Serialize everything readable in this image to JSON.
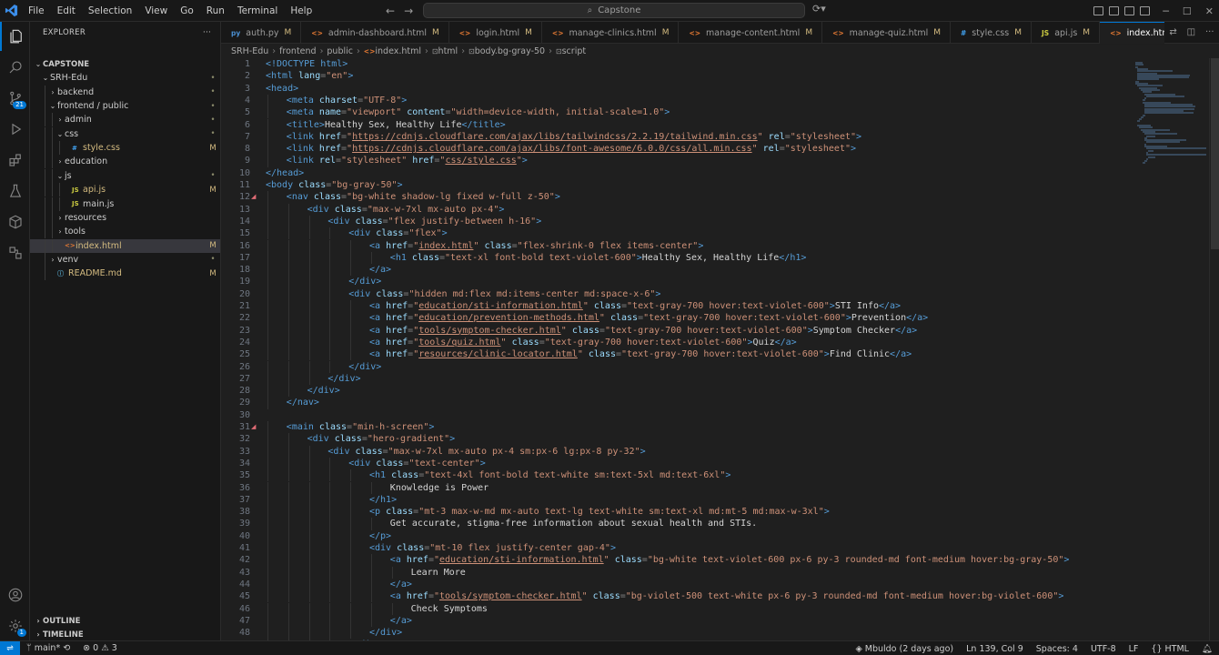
{
  "titlebar": {
    "logo": "VS",
    "menus": [
      "File",
      "Edit",
      "Selection",
      "View",
      "Go",
      "Run",
      "Terminal",
      "Help"
    ],
    "search_text": "Capstone"
  },
  "activity": {
    "scm_badge": "21",
    "accounts_badge": "1"
  },
  "explorer": {
    "title": "EXPLORER",
    "more": "···",
    "tree": [
      {
        "label": "CAPSTONE",
        "depth": 0,
        "chev": "v",
        "icon": "",
        "status": "",
        "bold": true
      },
      {
        "label": "SRH-Edu",
        "depth": 1,
        "chev": "v",
        "icon": "",
        "status": "•"
      },
      {
        "label": "backend",
        "depth": 2,
        "chev": ">",
        "icon": "",
        "status": "•"
      },
      {
        "label": "frontend / public",
        "depth": 2,
        "chev": "v",
        "icon": "",
        "status": "•"
      },
      {
        "label": "admin",
        "depth": 3,
        "chev": ">",
        "icon": "",
        "status": "•"
      },
      {
        "label": "css",
        "depth": 3,
        "chev": "v",
        "icon": "",
        "status": "•"
      },
      {
        "label": "style.css",
        "depth": 4,
        "chev": "",
        "icon": "css",
        "status": "M"
      },
      {
        "label": "education",
        "depth": 3,
        "chev": ">",
        "icon": "",
        "status": ""
      },
      {
        "label": "js",
        "depth": 3,
        "chev": "v",
        "icon": "",
        "status": "•"
      },
      {
        "label": "api.js",
        "depth": 4,
        "chev": "",
        "icon": "js",
        "status": "M"
      },
      {
        "label": "main.js",
        "depth": 4,
        "chev": "",
        "icon": "js",
        "status": ""
      },
      {
        "label": "resources",
        "depth": 3,
        "chev": ">",
        "icon": "",
        "status": ""
      },
      {
        "label": "tools",
        "depth": 3,
        "chev": ">",
        "icon": "",
        "status": ""
      },
      {
        "label": "index.html",
        "depth": 3,
        "chev": "",
        "icon": "html",
        "status": "M",
        "selected": true
      },
      {
        "label": "venv",
        "depth": 2,
        "chev": ">",
        "icon": "",
        "status": "•"
      },
      {
        "label": "README.md",
        "depth": 2,
        "chev": "",
        "icon": "md",
        "status": "M"
      }
    ],
    "outline": "OUTLINE",
    "timeline": "TIMELINE"
  },
  "tabs": [
    {
      "icon": "py",
      "label": "auth.py",
      "mod": "M"
    },
    {
      "icon": "<>",
      "label": "admin-dashboard.html",
      "mod": "M"
    },
    {
      "icon": "<>",
      "label": "login.html",
      "mod": "M"
    },
    {
      "icon": "<>",
      "label": "manage-clinics.html",
      "mod": "M"
    },
    {
      "icon": "<>",
      "label": "manage-content.html",
      "mod": "M"
    },
    {
      "icon": "<>",
      "label": "manage-quiz.html",
      "mod": "M"
    },
    {
      "icon": "#",
      "label": "style.css",
      "mod": "M"
    },
    {
      "icon": "JS",
      "label": "api.js",
      "mod": "M"
    },
    {
      "icon": "<>",
      "label": "index.html",
      "mod": "M",
      "active": true
    }
  ],
  "breadcrumbs": [
    "SRH-Edu",
    "frontend",
    "public",
    "index.html",
    "html",
    "body.bg-gray-50",
    "script"
  ],
  "code": [
    [
      0,
      [
        [
          "t",
          "<!DOCTYPE html>"
        ]
      ]
    ],
    [
      0,
      [
        [
          "t",
          "<html"
        ],
        [
          "a",
          " lang"
        ],
        [
          "p",
          "="
        ],
        [
          "s",
          "\"en\""
        ],
        [
          "t",
          ">"
        ]
      ]
    ],
    [
      0,
      [
        [
          "t",
          "<head>"
        ]
      ]
    ],
    [
      1,
      [
        [
          "t",
          "<meta"
        ],
        [
          "a",
          " charset"
        ],
        [
          "p",
          "="
        ],
        [
          "s",
          "\"UTF-8\""
        ],
        [
          "t",
          ">"
        ]
      ]
    ],
    [
      1,
      [
        [
          "t",
          "<meta"
        ],
        [
          "a",
          " name"
        ],
        [
          "p",
          "="
        ],
        [
          "s",
          "\"viewport\""
        ],
        [
          "a",
          " content"
        ],
        [
          "p",
          "="
        ],
        [
          "s",
          "\"width=device-width, initial-scale=1.0\""
        ],
        [
          "t",
          ">"
        ]
      ]
    ],
    [
      1,
      [
        [
          "t",
          "<title>"
        ],
        [
          "tx",
          "Healthy Sex, Healthy Life"
        ],
        [
          "t",
          "</title>"
        ]
      ]
    ],
    [
      1,
      [
        [
          "t",
          "<link"
        ],
        [
          "a",
          " href"
        ],
        [
          "p",
          "="
        ],
        [
          "s",
          "\""
        ],
        [
          "u",
          "https://cdnjs.cloudflare.com/ajax/libs/tailwindcss/2.2.19/tailwind.min.css"
        ],
        [
          "s",
          "\""
        ],
        [
          "a",
          " rel"
        ],
        [
          "p",
          "="
        ],
        [
          "s",
          "\"stylesheet\""
        ],
        [
          "t",
          ">"
        ]
      ]
    ],
    [
      1,
      [
        [
          "t",
          "<link"
        ],
        [
          "a",
          " href"
        ],
        [
          "p",
          "="
        ],
        [
          "s",
          "\""
        ],
        [
          "u",
          "https://cdnjs.cloudflare.com/ajax/libs/font-awesome/6.0.0/css/all.min.css"
        ],
        [
          "s",
          "\""
        ],
        [
          "a",
          " rel"
        ],
        [
          "p",
          "="
        ],
        [
          "s",
          "\"stylesheet\""
        ],
        [
          "t",
          ">"
        ]
      ]
    ],
    [
      1,
      [
        [
          "t",
          "<link"
        ],
        [
          "a",
          " rel"
        ],
        [
          "p",
          "="
        ],
        [
          "s",
          "\"stylesheet\""
        ],
        [
          "a",
          " href"
        ],
        [
          "p",
          "="
        ],
        [
          "s",
          "\""
        ],
        [
          "u",
          "css/style.css"
        ],
        [
          "s",
          "\""
        ],
        [
          "t",
          ">"
        ]
      ]
    ],
    [
      0,
      [
        [
          "t",
          "</head>"
        ]
      ]
    ],
    [
      0,
      [
        [
          "t",
          "<body"
        ],
        [
          "a",
          " class"
        ],
        [
          "p",
          "="
        ],
        [
          "s",
          "\"bg-gray-50\""
        ],
        [
          "t",
          ">"
        ]
      ]
    ],
    [
      1,
      [
        [
          "t",
          "<nav"
        ],
        [
          "a",
          " class"
        ],
        [
          "p",
          "="
        ],
        [
          "s",
          "\"bg-white shadow-lg fixed w-full z-50\""
        ],
        [
          "t",
          ">"
        ]
      ]
    ],
    [
      2,
      [
        [
          "t",
          "<div"
        ],
        [
          "a",
          " class"
        ],
        [
          "p",
          "="
        ],
        [
          "s",
          "\"max-w-7xl mx-auto px-4\""
        ],
        [
          "t",
          ">"
        ]
      ]
    ],
    [
      3,
      [
        [
          "t",
          "<div"
        ],
        [
          "a",
          " class"
        ],
        [
          "p",
          "="
        ],
        [
          "s",
          "\"flex justify-between h-16\""
        ],
        [
          "t",
          ">"
        ]
      ]
    ],
    [
      4,
      [
        [
          "t",
          "<div"
        ],
        [
          "a",
          " class"
        ],
        [
          "p",
          "="
        ],
        [
          "s",
          "\"flex\""
        ],
        [
          "t",
          ">"
        ]
      ]
    ],
    [
      5,
      [
        [
          "t",
          "<a"
        ],
        [
          "a",
          " href"
        ],
        [
          "p",
          "="
        ],
        [
          "s",
          "\""
        ],
        [
          "u",
          "index.html"
        ],
        [
          "s",
          "\""
        ],
        [
          "a",
          " class"
        ],
        [
          "p",
          "="
        ],
        [
          "s",
          "\"flex-shrink-0 flex items-center\""
        ],
        [
          "t",
          ">"
        ]
      ]
    ],
    [
      6,
      [
        [
          "t",
          "<h1"
        ],
        [
          "a",
          " class"
        ],
        [
          "p",
          "="
        ],
        [
          "s",
          "\"text-xl font-bold text-violet-600\""
        ],
        [
          "t",
          ">"
        ],
        [
          "tx",
          "Healthy Sex, Healthy Life"
        ],
        [
          "t",
          "</h1>"
        ]
      ]
    ],
    [
      5,
      [
        [
          "t",
          "</a>"
        ]
      ]
    ],
    [
      4,
      [
        [
          "t",
          "</div>"
        ]
      ]
    ],
    [
      4,
      [
        [
          "t",
          "<div"
        ],
        [
          "a",
          " class"
        ],
        [
          "p",
          "="
        ],
        [
          "s",
          "\"hidden md:flex md:items-center md:space-x-6\""
        ],
        [
          "t",
          ">"
        ]
      ]
    ],
    [
      5,
      [
        [
          "t",
          "<a"
        ],
        [
          "a",
          " href"
        ],
        [
          "p",
          "="
        ],
        [
          "s",
          "\""
        ],
        [
          "u",
          "education/sti-information.html"
        ],
        [
          "s",
          "\""
        ],
        [
          "a",
          " class"
        ],
        [
          "p",
          "="
        ],
        [
          "s",
          "\"text-gray-700 hover:text-violet-600\""
        ],
        [
          "t",
          ">"
        ],
        [
          "tx",
          "STI Info"
        ],
        [
          "t",
          "</a>"
        ]
      ]
    ],
    [
      5,
      [
        [
          "t",
          "<a"
        ],
        [
          "a",
          " href"
        ],
        [
          "p",
          "="
        ],
        [
          "s",
          "\""
        ],
        [
          "u",
          "education/prevention-methods.html"
        ],
        [
          "s",
          "\""
        ],
        [
          "a",
          " class"
        ],
        [
          "p",
          "="
        ],
        [
          "s",
          "\"text-gray-700 hover:text-violet-600\""
        ],
        [
          "t",
          ">"
        ],
        [
          "tx",
          "Prevention"
        ],
        [
          "t",
          "</a>"
        ]
      ]
    ],
    [
      5,
      [
        [
          "t",
          "<a"
        ],
        [
          "a",
          " href"
        ],
        [
          "p",
          "="
        ],
        [
          "s",
          "\""
        ],
        [
          "u",
          "tools/symptom-checker.html"
        ],
        [
          "s",
          "\""
        ],
        [
          "a",
          " class"
        ],
        [
          "p",
          "="
        ],
        [
          "s",
          "\"text-gray-700 hover:text-violet-600\""
        ],
        [
          "t",
          ">"
        ],
        [
          "tx",
          "Symptom Checker"
        ],
        [
          "t",
          "</a>"
        ]
      ]
    ],
    [
      5,
      [
        [
          "t",
          "<a"
        ],
        [
          "a",
          " href"
        ],
        [
          "p",
          "="
        ],
        [
          "s",
          "\""
        ],
        [
          "u",
          "tools/quiz.html"
        ],
        [
          "s",
          "\""
        ],
        [
          "a",
          " class"
        ],
        [
          "p",
          "="
        ],
        [
          "s",
          "\"text-gray-700 hover:text-violet-600\""
        ],
        [
          "t",
          ">"
        ],
        [
          "tx",
          "Quiz"
        ],
        [
          "t",
          "</a>"
        ]
      ]
    ],
    [
      5,
      [
        [
          "t",
          "<a"
        ],
        [
          "a",
          " href"
        ],
        [
          "p",
          "="
        ],
        [
          "s",
          "\""
        ],
        [
          "u",
          "resources/clinic-locator.html"
        ],
        [
          "s",
          "\""
        ],
        [
          "a",
          " class"
        ],
        [
          "p",
          "="
        ],
        [
          "s",
          "\"text-gray-700 hover:text-violet-600\""
        ],
        [
          "t",
          ">"
        ],
        [
          "tx",
          "Find Clinic"
        ],
        [
          "t",
          "</a>"
        ]
      ]
    ],
    [
      4,
      [
        [
          "t",
          "</div>"
        ]
      ]
    ],
    [
      3,
      [
        [
          "t",
          "</div>"
        ]
      ]
    ],
    [
      2,
      [
        [
          "t",
          "</div>"
        ]
      ]
    ],
    [
      1,
      [
        [
          "t",
          "</nav>"
        ]
      ]
    ],
    [
      0,
      []
    ],
    [
      1,
      [
        [
          "t",
          "<main"
        ],
        [
          "a",
          " class"
        ],
        [
          "p",
          "="
        ],
        [
          "s",
          "\"min-h-screen\""
        ],
        [
          "t",
          ">"
        ]
      ]
    ],
    [
      2,
      [
        [
          "t",
          "<div"
        ],
        [
          "a",
          " class"
        ],
        [
          "p",
          "="
        ],
        [
          "s",
          "\"hero-gradient\""
        ],
        [
          "t",
          ">"
        ]
      ]
    ],
    [
      3,
      [
        [
          "t",
          "<div"
        ],
        [
          "a",
          " class"
        ],
        [
          "p",
          "="
        ],
        [
          "s",
          "\"max-w-7xl mx-auto px-4 sm:px-6 lg:px-8 py-32\""
        ],
        [
          "t",
          ">"
        ]
      ]
    ],
    [
      4,
      [
        [
          "t",
          "<div"
        ],
        [
          "a",
          " class"
        ],
        [
          "p",
          "="
        ],
        [
          "s",
          "\"text-center\""
        ],
        [
          "t",
          ">"
        ]
      ]
    ],
    [
      5,
      [
        [
          "t",
          "<h1"
        ],
        [
          "a",
          " class"
        ],
        [
          "p",
          "="
        ],
        [
          "s",
          "\"text-4xl font-bold text-white sm:text-5xl md:text-6xl\""
        ],
        [
          "t",
          ">"
        ]
      ]
    ],
    [
      6,
      [
        [
          "tx",
          "Knowledge is Power"
        ]
      ]
    ],
    [
      5,
      [
        [
          "t",
          "</h1>"
        ]
      ]
    ],
    [
      5,
      [
        [
          "t",
          "<p"
        ],
        [
          "a",
          " class"
        ],
        [
          "p",
          "="
        ],
        [
          "s",
          "\"mt-3 max-w-md mx-auto text-lg text-white sm:text-xl md:mt-5 md:max-w-3xl\""
        ],
        [
          "t",
          ">"
        ]
      ]
    ],
    [
      6,
      [
        [
          "tx",
          "Get accurate, stigma-free information about sexual health and STIs."
        ]
      ]
    ],
    [
      5,
      [
        [
          "t",
          "</p>"
        ]
      ]
    ],
    [
      5,
      [
        [
          "t",
          "<div"
        ],
        [
          "a",
          " class"
        ],
        [
          "p",
          "="
        ],
        [
          "s",
          "\"mt-10 flex justify-center gap-4\""
        ],
        [
          "t",
          ">"
        ]
      ]
    ],
    [
      6,
      [
        [
          "t",
          "<a"
        ],
        [
          "a",
          " href"
        ],
        [
          "p",
          "="
        ],
        [
          "s",
          "\""
        ],
        [
          "u",
          "education/sti-information.html"
        ],
        [
          "s",
          "\""
        ],
        [
          "a",
          " class"
        ],
        [
          "p",
          "="
        ],
        [
          "s",
          "\"bg-white text-violet-600 px-6 py-3 rounded-md font-medium hover:bg-gray-50\""
        ],
        [
          "t",
          ">"
        ]
      ]
    ],
    [
      7,
      [
        [
          "tx",
          "Learn More"
        ]
      ]
    ],
    [
      6,
      [
        [
          "t",
          "</a>"
        ]
      ]
    ],
    [
      6,
      [
        [
          "t",
          "<a"
        ],
        [
          "a",
          " href"
        ],
        [
          "p",
          "="
        ],
        [
          "s",
          "\""
        ],
        [
          "u",
          "tools/symptom-checker.html"
        ],
        [
          "s",
          "\""
        ],
        [
          "a",
          " class"
        ],
        [
          "p",
          "="
        ],
        [
          "s",
          "\"bg-violet-500 text-white px-6 py-3 rounded-md font-medium hover:bg-violet-600\""
        ],
        [
          "t",
          ">"
        ]
      ]
    ],
    [
      7,
      [
        [
          "tx",
          "Check Symptoms"
        ]
      ]
    ],
    [
      6,
      [
        [
          "t",
          "</a>"
        ]
      ]
    ],
    [
      5,
      [
        [
          "t",
          "</div>"
        ]
      ]
    ],
    [
      4,
      [
        [
          "t",
          "</div>"
        ]
      ]
    ]
  ],
  "markers": [
    12,
    31
  ],
  "status": {
    "branch": "main*",
    "errors": "0",
    "warnings": "3",
    "blame": "Mbuldo (2 days ago)",
    "position": "Ln 139, Col 9",
    "spaces": "Spaces: 4",
    "encoding": "UTF-8",
    "eol": "LF",
    "language": "HTML"
  }
}
